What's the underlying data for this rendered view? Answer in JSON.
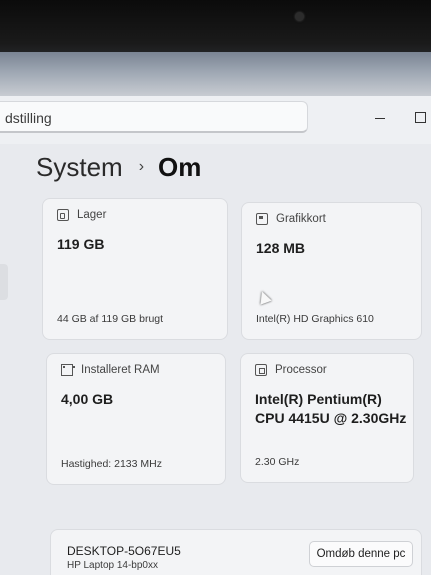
{
  "search": {
    "text": "dstilling"
  },
  "breadcrumb": {
    "parent": "System",
    "separator": "›",
    "current": "Om"
  },
  "cards": {
    "storage": {
      "title": "Lager",
      "value": "119 GB",
      "detail": "44 GB af 119 GB brugt",
      "icon": "storage-icon"
    },
    "gpu": {
      "title": "Grafikkort",
      "value": "128 MB",
      "detail": "Intel(R) HD Graphics 610",
      "icon": "graphics-card-icon"
    },
    "ram": {
      "title": "Installeret RAM",
      "value": "4,00 GB",
      "detail": "Hastighed: 2133 MHz",
      "icon": "ram-icon"
    },
    "cpu": {
      "title": "Processor",
      "value_line1": "Intel(R) Pentium(R)",
      "value_line2": "CPU 4415U @ 2.30GHz",
      "detail": "2.30 GHz",
      "icon": "processor-icon"
    }
  },
  "device": {
    "name": "DESKTOP-5O67EU5",
    "model": "HP Laptop 14-bp0xx",
    "rename_label": "Omdøb denne pc"
  }
}
